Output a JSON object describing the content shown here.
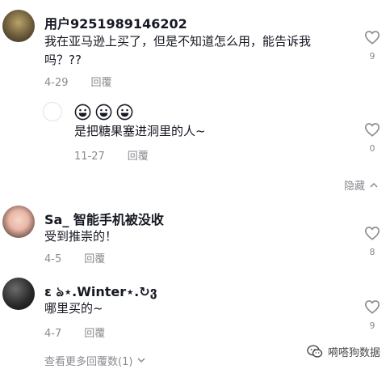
{
  "comments": [
    {
      "username": "用户9251989146202",
      "text": "我在亚马逊上买了，但是不知道怎么用，能告诉我吗？??",
      "date": "4-29",
      "reply_label": "回覆",
      "likes": "9"
    },
    {
      "emojis": [
        "grin-emoji",
        "grin-emoji",
        "grin-emoji"
      ],
      "text": "是把糖果塞进洞里的人~",
      "date": "11-27",
      "reply_label": "回覆",
      "likes": "0"
    },
    {
      "username": "Sa_ 智能手机被没收",
      "text": "受到推崇的！",
      "date": "4-5",
      "reply_label": "回覆",
      "likes": "8"
    },
    {
      "username": "ɛ ঌ⋆.Winter⋆.↻ვ",
      "text": "哪里买的~",
      "date": "4-7",
      "reply_label": "回覆",
      "likes": "9"
    }
  ],
  "hide_label": "隐藏",
  "more_replies_label": "查看更多回覆数(1)",
  "watermark": "嗬嗒狗数据",
  "colors": {
    "muted": "#8a8b91",
    "text": "#161823"
  }
}
